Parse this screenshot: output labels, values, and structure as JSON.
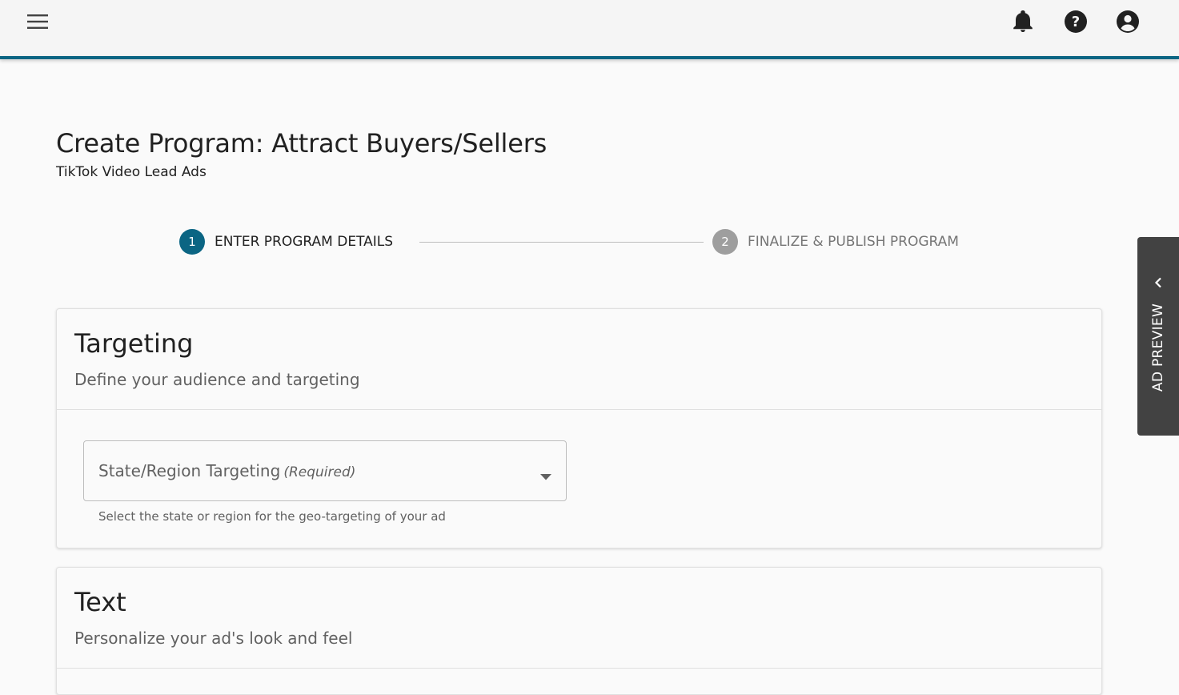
{
  "header": {
    "menu_icon": "hamburger-menu-icon",
    "notifications_icon": "bell-icon",
    "help_icon": "question-circle-icon",
    "account_icon": "account-circle-icon",
    "accent_color": "#0b6583"
  },
  "page": {
    "title": "Create Program: Attract Buyers/Sellers",
    "subtitle": "TikTok Video Lead Ads"
  },
  "stepper": {
    "steps": [
      {
        "number": "1",
        "label": "ENTER PROGRAM DETAILS",
        "state": "active"
      },
      {
        "number": "2",
        "label": "FINALIZE & PUBLISH PROGRAM",
        "state": "inactive"
      }
    ]
  },
  "targeting_card": {
    "title": "Targeting",
    "description": "Define your audience and targeting",
    "state_region_select": {
      "label": "State/Region Targeting",
      "required_tag": "(Required)",
      "value": "",
      "helper": "Select the state or region for the geo-targeting of your ad"
    }
  },
  "text_card": {
    "title": "Text",
    "description": "Personalize your ad's look and feel"
  },
  "side_panel": {
    "label": "AD PREVIEW",
    "icon": "chevron-left-icon"
  }
}
